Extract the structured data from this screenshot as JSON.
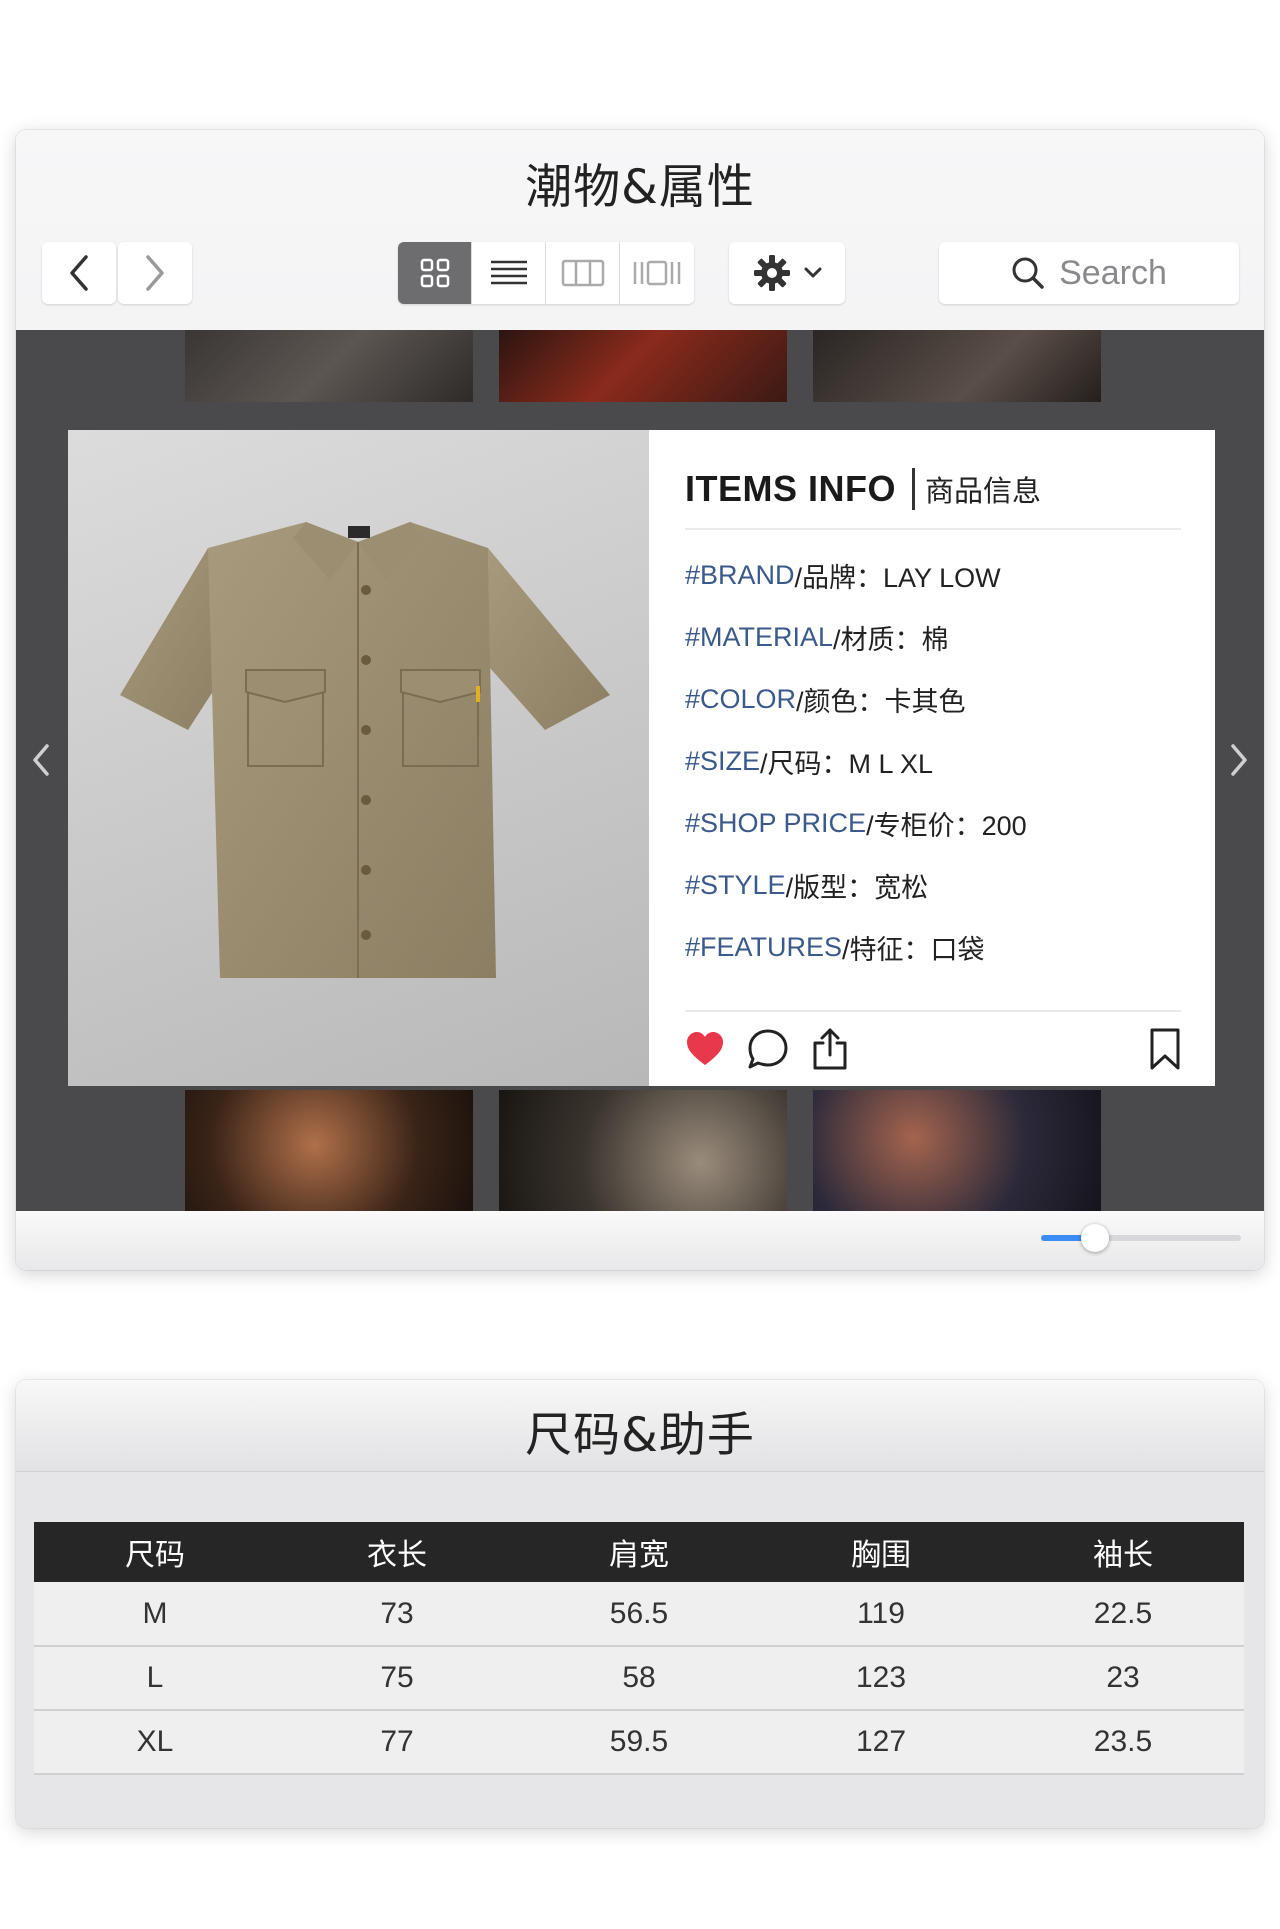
{
  "window1": {
    "title": "潮物&属性",
    "search": {
      "placeholder": "Search"
    },
    "colors": {
      "accent": "#3b8cf5",
      "like": "#e8384b",
      "attr_key": "#3a5a8c"
    },
    "toolbar_icons": [
      "chevron-left-icon",
      "chevron-right-icon",
      "grid-view-icon",
      "list-view-icon",
      "column-view-icon",
      "gallery-view-icon",
      "gear-icon",
      "chevron-down-icon",
      "search-icon"
    ],
    "card": {
      "title": "ITEMS INFO",
      "subtitle": "商品信息",
      "attributes": [
        {
          "key": "#BRAND",
          "rest": "/品牌：LAY LOW"
        },
        {
          "key": "#MATERIAL",
          "rest": "/材质：棉"
        },
        {
          "key": "#COLOR",
          "rest": "/颜色：卡其色"
        },
        {
          "key": "#SIZE",
          "rest": "/尺码：M L XL"
        },
        {
          "key": "#SHOP PRICE",
          "rest": "/专柜价：200"
        },
        {
          "key": "#STYLE",
          "rest": "/版型：宽松"
        },
        {
          "key": "#FEATURES",
          "rest": "/特征：口袋"
        }
      ],
      "actions": [
        "heart-icon",
        "comment-icon",
        "share-icon",
        "bookmark-icon"
      ]
    },
    "zoom_slider": {
      "value": 0.27
    }
  },
  "window2": {
    "title": "尺码&助手",
    "table": {
      "headers": [
        "尺码",
        "衣长",
        "肩宽",
        "胸围",
        "袖长"
      ],
      "rows": [
        [
          "M",
          "73",
          "56.5",
          "119",
          "22.5"
        ],
        [
          "L",
          "75",
          "58",
          "123",
          "23"
        ],
        [
          "XL",
          "77",
          "59.5",
          "127",
          "23.5"
        ]
      ]
    }
  }
}
